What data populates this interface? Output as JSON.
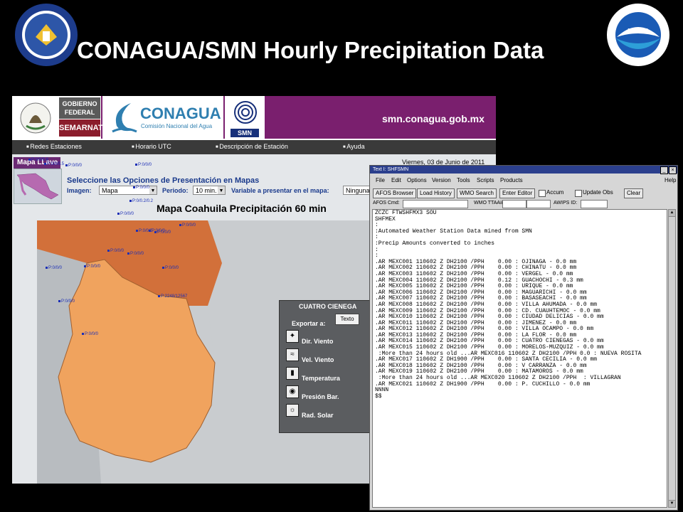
{
  "slide": {
    "title": "CONAGUA/SMN Hourly Precipitation Data",
    "left_logo": "department-of-commerce-seal",
    "right_logo": "noaa-seal"
  },
  "web": {
    "gobierno": "GOBIERNO FEDERAL",
    "semarnat": "SEMARNAT",
    "conagua": "CONAGUA",
    "conagua_sub": "Comisión Nacional del Agua",
    "smn": "SMN",
    "url": "smn.conagua.gob.mx",
    "nav": [
      "Redes Estaciones",
      "Horario UTC",
      "Descripción de Estación",
      "Ayuda"
    ],
    "date": "Viernes, 03 de Junio de 2011",
    "tab": "Mapa LLave",
    "select_title": "Seleccione las Opciones de Presentación en Mapas",
    "imagen_label": "Imagen:",
    "imagen_value": "Mapa",
    "periodo_label": "Periodo:",
    "periodo_value": "10 min.",
    "variable_label": "Variable a presentar en el mapa:",
    "variable_value": "Ninguna",
    "map_title": "Mapa Coahuila Precipitación 60 min",
    "station_labels": [
      "P:0/0/0.6",
      "P:0/0/0.5",
      "P:0/0/0",
      "P:0/0/0",
      "P:0/0/0",
      "P:0/0.2/0.2",
      "P:0/0/0",
      "P:0/0/0",
      "P:0/0/0",
      "P:0/0/0",
      "P:0/0/0",
      "P:0/0/0",
      "P:0/0/0",
      "P:0/0/0",
      "P:0/0/0",
      "P:0/0/0",
      "P:0/0/0",
      "P:0/0/0",
      "P:2248/12567"
    ],
    "panel": {
      "title": "CUATRO CIENEGA",
      "exportar": "Exportar a:",
      "texto_button": "Texto",
      "items": [
        "Dir. Viento",
        "Vel. Viento",
        "Temperatura",
        "Presión Bar.",
        "Rad. Solar"
      ]
    }
  },
  "terminal": {
    "title": "Text I: SHFSMN",
    "menu": [
      "File",
      "Edit",
      "Options",
      "Version",
      "Tools",
      "Scripts",
      "Products",
      "Help"
    ],
    "buttons": [
      "AFOS Browser",
      "Load History",
      "WMO Search",
      "Enter Editor",
      "Clear"
    ],
    "checkboxes": [
      "Accum",
      "Update Obs"
    ],
    "fields": [
      "AFOS Cmd:",
      "WMO TTAAii CCCC:",
      "AWIPS ID:"
    ],
    "text": "ZCZC FTWSHFMX3 SOU\nSHFMEX\n:\n:Automated Weather Station Data mined from SMN\n:\n:Precip Amounts converted to inches\n:\n:\n.AR MEXC001 110602 Z DH2100 /PPH    0.00 : OJINAGA - 0.0 mm\n.AR MEXC002 110602 Z DH2100 /PPH    0.00 : CHINATU - 0.0 mm\n.AR MEXC003 110602 Z DH2100 /PPH    0.00 : VERGEL - 0.0 mm\n.AR MEXC004 110602 Z DH2100 /PPH    0.12 : GUACHOCHI - 0.3 mm\n.AR MEXC005 110602 Z DH2100 /PPH    0.00 : URIQUE - 0.0 mm\n.AR MEXC006 110602 Z DH2100 /PPH    0.00 : MAGUARICHI - 0.0 mm\n.AR MEXC007 110602 Z DH2100 /PPH    0.00 : BASASEACHI - 0.0 mm\n.AR MEXC008 110602 Z DH2100 /PPH    0.00 : VILLA AHUMADA - 0.0 mm\n.AR MEXC009 110602 Z DH2100 /PPH    0.00 : CD. CUAUHTEMOC - 0.0 mm\n.AR MEXC010 110602 Z DH2100 /PPH    0.00 : CIUDAD DELICIAS - 0.0 mm\n.AR MEXC011 110602 Z DH2100 /PPH    0.00 : JIMENEZ - 0.0 mm\n.AR MEXC012 110602 Z DH2100 /PPH    0.00 : VILLA OCAMPO - 0.0 mm\n.AR MEXC013 110602 Z DH2100 /PPH    0.00 : LA FLOR - 0.0 mm\n.AR MEXC014 110602 Z DH2100 /PPH    0.00 : CUATRO CIENEGAS - 0.0 mm\n.AR MEXC015 110602 Z DH2100 /PPH    0.00 : MORELOS-MUZQUIZ - 0.0 mm\n :More than 24 hours old ...AR MEXC016 110602 Z DH2100 /PPH 0.0 : NUEVA ROSITA\n.AR MEXC017 110602 Z DH1900 /PPH    0.00 : SANTA CECILIA - 0.0 mm\n.AR MEXC018 110602 Z DH2100 /PPH    0.00 : V CARRANZA - 0.0 mm\n.AR MEXC019 110602 Z DH2100 /PPH    0.00 : MATAMOROS - 0.0 mm\n :More than 24 hours old ...AR MEXC020 110602 Z DH2100 /PPH  : VILLAGRAN\n.AR MEXC021 110602 Z DH1900 /PPH    0.00 : P. CUCHILLO - 0.0 mm\nNNNN\n$$"
  },
  "colors": {
    "banner": "#7a1f6e",
    "map_state": "#f0a35e",
    "map_neighbor": "#d2703a",
    "terminal_titlebar": "#2b3f8d"
  }
}
